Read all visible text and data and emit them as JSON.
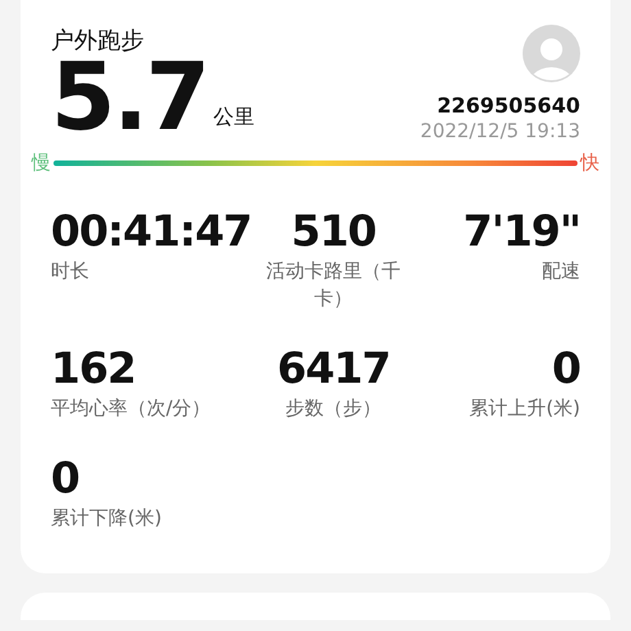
{
  "activity": {
    "title": "户外跑步",
    "distance": "5.7",
    "unit": "公里",
    "user_id": "2269505640",
    "datetime": "2022/12/5 19:13"
  },
  "pace_scale": {
    "slow": "慢",
    "fast": "快"
  },
  "stats": [
    {
      "value": "00:41:47",
      "label": "时长"
    },
    {
      "value": "510",
      "label": "活动卡路里（千卡）"
    },
    {
      "value": "7'19\"",
      "label": "配速"
    },
    {
      "value": "162",
      "label": "平均心率（次/分）"
    },
    {
      "value": "6417",
      "label": "步数（步）"
    },
    {
      "value": "0",
      "label": "累计上升(米)"
    },
    {
      "value": "0",
      "label": "累计下降(米)"
    }
  ]
}
